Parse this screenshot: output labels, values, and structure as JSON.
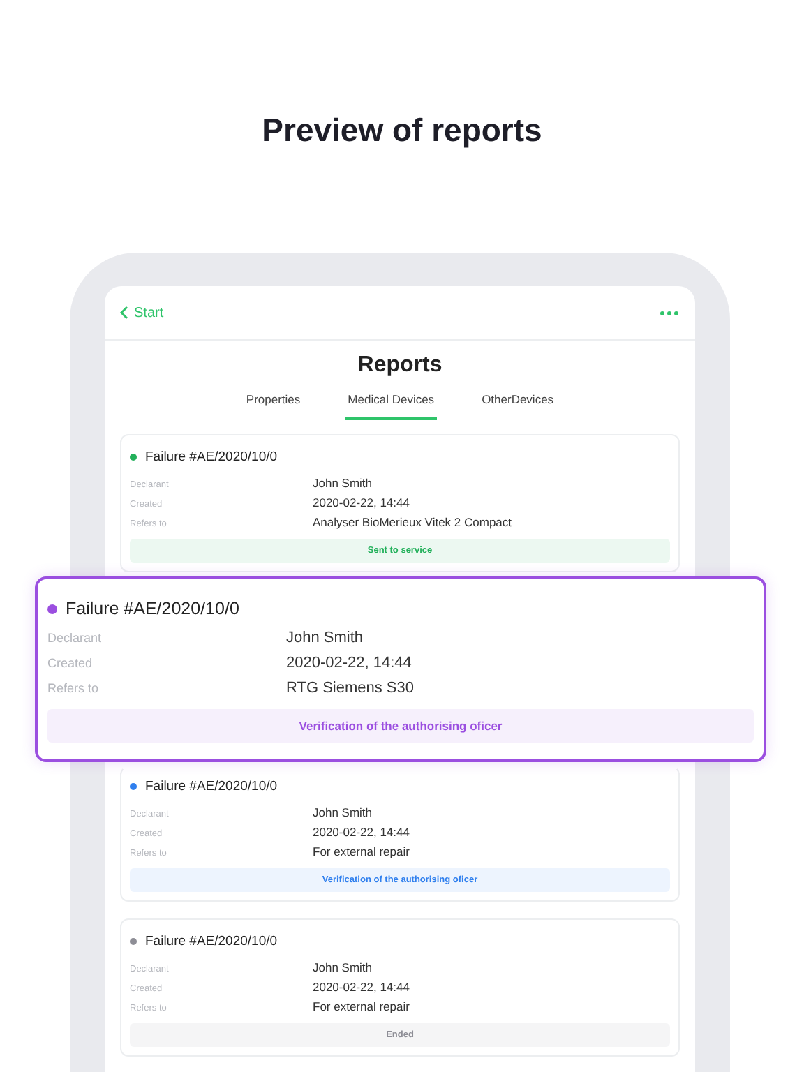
{
  "headline": "Preview of reports",
  "nav": {
    "back_label": "Start"
  },
  "title": "Reports",
  "tabs": [
    {
      "label": "Properties",
      "selected": false
    },
    {
      "label": "Medical Devices",
      "selected": true
    },
    {
      "label": "OtherDevices",
      "selected": false
    }
  ],
  "reports": [
    {
      "title": "Failure #AE/2020/10/0",
      "color": "#22b05a",
      "highlighted": false,
      "fields": [
        {
          "label": "Declarant",
          "value": "John Smith"
        },
        {
          "label": "Created",
          "value": "2020-02-22, 14:44"
        },
        {
          "label": "Refers to",
          "value": "Analyser BioMerieux Vitek 2 Compact"
        }
      ],
      "status": "Sent to service"
    },
    {
      "title": "Failure #AE/2020/10/0",
      "color": "#9b4fe0",
      "highlighted": true,
      "fields": [
        {
          "label": "Declarant",
          "value": "John Smith"
        },
        {
          "label": "Created",
          "value": "2020-02-22, 14:44"
        },
        {
          "label": "Refers to",
          "value": "RTG Siemens S30"
        }
      ],
      "status": "Verification of the authorising oficer"
    },
    {
      "title": "Failure #AE/2020/10/0",
      "color": "#2f7fee",
      "highlighted": false,
      "fields": [
        {
          "label": "Declarant",
          "value": "John Smith"
        },
        {
          "label": "Created",
          "value": "2020-02-22, 14:44"
        },
        {
          "label": "Refers to",
          "value": "For external repair"
        }
      ],
      "status": "Verification of the authorising oficer"
    },
    {
      "title": "Failure #AE/2020/10/0",
      "color": "#8e8e96",
      "highlighted": false,
      "fields": [
        {
          "label": "Declarant",
          "value": "John Smith"
        },
        {
          "label": "Created",
          "value": "2020-02-22, 14:44"
        },
        {
          "label": "Refers to",
          "value": "For external repair"
        }
      ],
      "status": "Ended"
    }
  ]
}
